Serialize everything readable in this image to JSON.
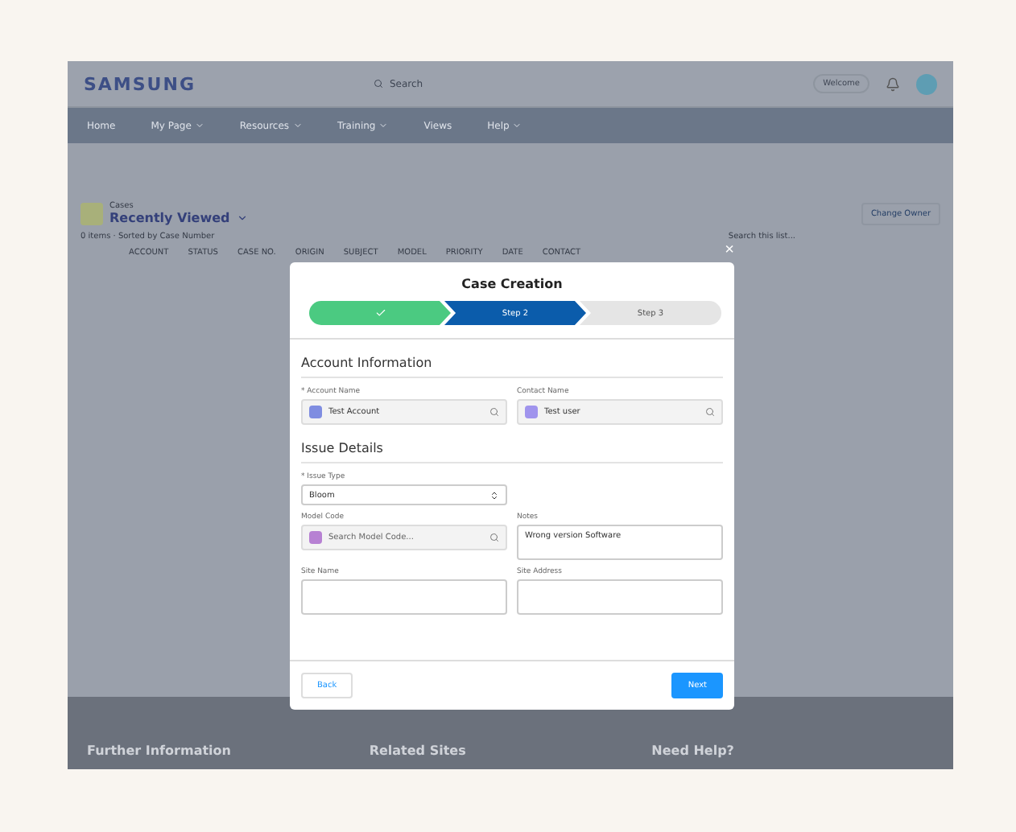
{
  "header": {
    "logo": "SAMSUNG",
    "search": {
      "placeholder": "Search"
    },
    "user": "Welcome"
  },
  "nav": [
    {
      "label": "Home",
      "menu": false
    },
    {
      "label": "My Page",
      "menu": true
    },
    {
      "label": "Resources",
      "menu": true
    },
    {
      "label": "Training",
      "menu": true
    },
    {
      "label": "Views",
      "menu": false
    },
    {
      "label": "Help",
      "menu": true
    }
  ],
  "list": {
    "object": "Cases",
    "title": "Recently Viewed",
    "meta": "0 items · Sorted by Case Number",
    "action": "Change Owner",
    "search": {
      "placeholder": "Search this list..."
    },
    "columns": [
      "ACCOUNT",
      "STATUS",
      "CASE NO.",
      "ORIGIN",
      "SUBJECT",
      "MODEL",
      "PRIORITY",
      "DATE",
      "CONTACT"
    ]
  },
  "modal": {
    "title": "Case Creation",
    "close": "×",
    "steps": [
      {
        "kind": "complete"
      },
      {
        "label": "Step 2",
        "kind": "current"
      },
      {
        "label": "Step 3",
        "kind": "upcoming"
      }
    ],
    "sections": [
      {
        "title": "Account Information",
        "fields": [
          {
            "kind": "lookup",
            "label": "* Account Name",
            "value": "Test Account",
            "color": "#7f8de1"
          },
          {
            "kind": "lookup",
            "label": "Contact Name",
            "value": "Test user",
            "color": "#a094ed"
          }
        ]
      },
      {
        "title": "Issue Details",
        "fields": [
          {
            "kind": "select",
            "label": "* Issue Type",
            "value": "Bloom"
          },
          {
            "kind": "spacer"
          },
          {
            "kind": "lookup",
            "label": "Model Code",
            "placeholder": "Search Model Code...",
            "color": "#b781d3"
          },
          {
            "kind": "textarea",
            "label": "Notes",
            "value": "Wrong version Software"
          },
          {
            "kind": "textarea",
            "label": "Site Name"
          },
          {
            "kind": "textarea",
            "label": "Site Address"
          }
        ]
      }
    ],
    "buttons": [
      {
        "label": "Back",
        "kind": "secondary"
      },
      {
        "label": "Next",
        "kind": "primary"
      }
    ]
  },
  "footer": [
    "Further Information",
    "Related Sites",
    "Need Help?"
  ]
}
